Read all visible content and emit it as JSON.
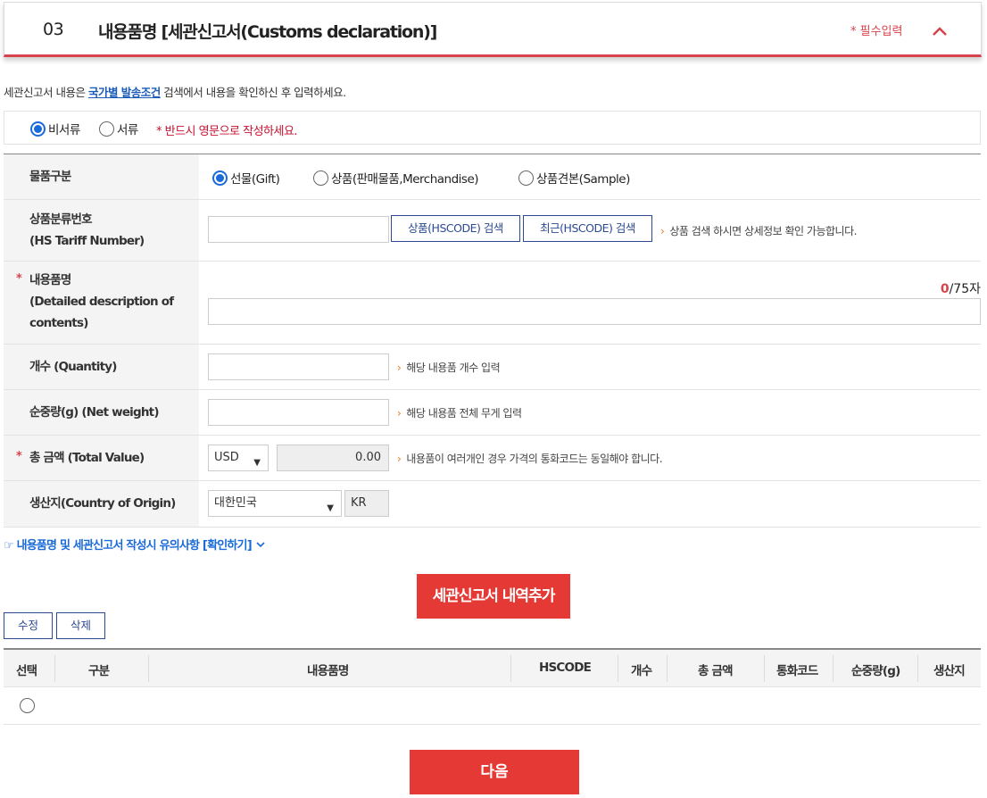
{
  "header": {
    "number": "03",
    "title": "내용품명 [세관신고서(Customs declaration)]",
    "required_label": "* 필수입력"
  },
  "notice": {
    "prefix": "세관신고서 내용은 ",
    "link": "국가별 발송조건",
    "suffix": " 검색에서 내용을 확인하신 후 입력하세요."
  },
  "doc_type": {
    "options": [
      "비서류",
      "서류"
    ],
    "selected": "비서류",
    "warning": "* 반드시 영문으로 작성하세요."
  },
  "form": {
    "category": {
      "label": "물품구분",
      "options": [
        "선물(Gift)",
        "상품(판매물품,Merchandise)",
        "상품견본(Sample)"
      ],
      "selected": "선물(Gift)"
    },
    "hs_code": {
      "label_line1": "상품분류번호",
      "label_line2": "(HS Tariff Number)",
      "value": "",
      "search_button": "상품(HSCODE) 검색",
      "recent_button": "최근(HSCODE) 검색",
      "hint": "상품 검색 하시면 상세정보 확인 가능합니다."
    },
    "description": {
      "required": "*",
      "label_line1": "내용품명",
      "label_line2": "(Detailed description of",
      "label_line3": "contents)",
      "value": "",
      "count_current": "0",
      "count_max": "/75자"
    },
    "quantity": {
      "label": "개수 (Quantity)",
      "value": "",
      "hint": "해당 내용품 개수 입력"
    },
    "net_weight": {
      "label": "순중량(g) (Net weight)",
      "value": "",
      "hint": "해당 내용품 전체 무게 입력"
    },
    "total_value": {
      "required": "*",
      "label": "총 금액 (Total Value)",
      "currency": "USD",
      "amount": "0.00",
      "hint": "내용품이 여러개인 경우 가격의 통화코드는 동일해야 합니다."
    },
    "origin": {
      "label": "생산지(Country of Origin)",
      "country": "대한민국",
      "code": "KR"
    }
  },
  "caution_link": "☞ 내용품명 및 세관신고서 작성시 유의사항 [확인하기]",
  "add_button": "세관신고서 내역추가",
  "edit_button": "수정",
  "delete_button": "삭제",
  "table": {
    "headers": [
      "선택",
      "구분",
      "내용품명",
      "HSCODE",
      "개수",
      "총 금액",
      "통화코드",
      "순중량(g)",
      "생산지"
    ],
    "rows": [
      []
    ]
  },
  "next_button": "다음",
  "colors": {
    "accent_red": "#e53935",
    "link_blue": "#1a5bb8",
    "radio_blue": "#1a6ad8",
    "button_navy": "#2c4a91"
  }
}
